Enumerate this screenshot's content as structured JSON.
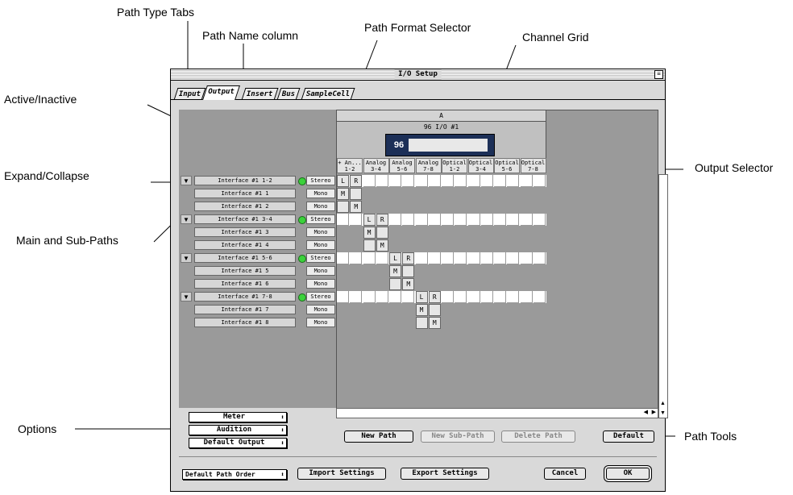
{
  "callouts": {
    "path_type_tabs": "Path Type Tabs",
    "path_name_column": "Path Name column",
    "path_format_selector": "Path Format Selector",
    "channel_grid": "Channel Grid",
    "active_inactive": "Active/Inactive",
    "expand_collapse": "Expand/Collapse",
    "main_and_sub_paths": "Main and Sub-Paths",
    "output_selector": "Output Selector",
    "options": "Options",
    "path_tools": "Path Tools"
  },
  "window": {
    "title": "I/O Setup",
    "tabs": [
      "Input",
      "Output",
      "Insert",
      "Bus",
      "SampleCell"
    ],
    "active_tab": "Output"
  },
  "device": {
    "header": "A",
    "name": "96 I/O #1",
    "badge": "96"
  },
  "channel_headers": [
    {
      "l1": "+ An...",
      "l2": "1-2"
    },
    {
      "l1": "Analog",
      "l2": "3-4"
    },
    {
      "l1": "Analog",
      "l2": "5-6"
    },
    {
      "l1": "Analog",
      "l2": "7-8"
    },
    {
      "l1": "Optical",
      "l2": "1-2"
    },
    {
      "l1": "Optical",
      "l2": "3-4"
    },
    {
      "l1": "Optical",
      "l2": "5-6"
    },
    {
      "l1": "Optical",
      "l2": "7-8"
    }
  ],
  "paths": [
    {
      "name": "Interface #1 1-2",
      "format": "Stereo",
      "main": true,
      "active": true,
      "cells": [
        {
          "col": 0,
          "label": "L"
        },
        {
          "col": 1,
          "label": "R"
        }
      ]
    },
    {
      "name": "Interface #1 1",
      "format": "Mono",
      "main": false,
      "cells": [
        {
          "col": 0,
          "label": "M"
        },
        {
          "col": 1,
          "label": ""
        }
      ]
    },
    {
      "name": "Interface #1 2",
      "format": "Mono",
      "main": false,
      "cells": [
        {
          "col": 0,
          "label": ""
        },
        {
          "col": 1,
          "label": "M"
        }
      ]
    },
    {
      "name": "Interface #1 3-4",
      "format": "Stereo",
      "main": true,
      "active": true,
      "cells": [
        {
          "col": 2,
          "label": "L"
        },
        {
          "col": 3,
          "label": "R"
        }
      ]
    },
    {
      "name": "Interface #1 3",
      "format": "Mono",
      "main": false,
      "cells": [
        {
          "col": 2,
          "label": "M"
        },
        {
          "col": 3,
          "label": ""
        }
      ]
    },
    {
      "name": "Interface #1 4",
      "format": "Mono",
      "main": false,
      "cells": [
        {
          "col": 2,
          "label": ""
        },
        {
          "col": 3,
          "label": "M"
        }
      ]
    },
    {
      "name": "Interface #1 5-6",
      "format": "Stereo",
      "main": true,
      "active": true,
      "cells": [
        {
          "col": 4,
          "label": "L"
        },
        {
          "col": 5,
          "label": "R"
        }
      ]
    },
    {
      "name": "Interface #1 5",
      "format": "Mono",
      "main": false,
      "cells": [
        {
          "col": 4,
          "label": "M"
        },
        {
          "col": 5,
          "label": ""
        }
      ]
    },
    {
      "name": "Interface #1 6",
      "format": "Mono",
      "main": false,
      "cells": [
        {
          "col": 4,
          "label": ""
        },
        {
          "col": 5,
          "label": "M"
        }
      ]
    },
    {
      "name": "Interface #1 7-8",
      "format": "Stereo",
      "main": true,
      "active": true,
      "cells": [
        {
          "col": 6,
          "label": "L"
        },
        {
          "col": 7,
          "label": "R"
        }
      ]
    },
    {
      "name": "Interface #1 7",
      "format": "Mono",
      "main": false,
      "cells": [
        {
          "col": 6,
          "label": "M"
        },
        {
          "col": 7,
          "label": ""
        }
      ]
    },
    {
      "name": "Interface #1 8",
      "format": "Mono",
      "main": false,
      "cells": [
        {
          "col": 6,
          "label": ""
        },
        {
          "col": 7,
          "label": "M"
        }
      ]
    }
  ],
  "options": [
    "Meter",
    "Audition",
    "Default Output"
  ],
  "path_tools": {
    "new_path": "New Path",
    "new_sub_path": "New Sub-Path",
    "delete_path": "Delete Path",
    "default": "Default"
  },
  "bottom": {
    "path_order": "Default Path Order",
    "import": "Import Settings",
    "export": "Export Settings",
    "cancel": "Cancel",
    "ok": "OK"
  },
  "icons": {
    "expand": "triangle-down-icon",
    "led": "green-dot-icon",
    "popup": "updown-arrows-icon"
  },
  "colors": {
    "led_green": "#3bd23b",
    "grid_gray": "#9a9a9a",
    "device_blue": "#1c2f57"
  }
}
